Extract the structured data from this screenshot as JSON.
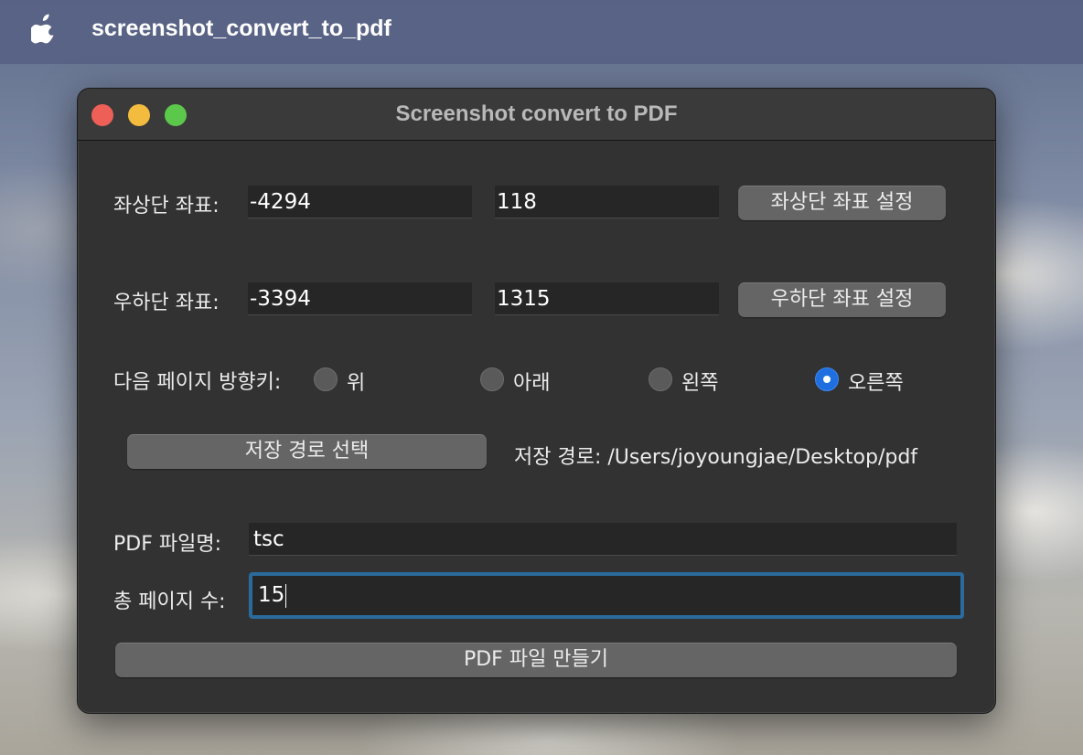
{
  "menubar": {
    "app_name": "screenshot_convert_to_pdf"
  },
  "window": {
    "title": "Screenshot convert to PDF"
  },
  "top_left": {
    "label": "좌상단 좌표:",
    "x_value": "-4294",
    "y_value": "118",
    "button_label": "좌상단 좌표 설정"
  },
  "bottom_right": {
    "label": "우하단 좌표:",
    "x_value": "-3394",
    "y_value": "1315",
    "button_label": "우하단 좌표 설정"
  },
  "direction": {
    "label": "다음 페이지 방향키:",
    "options": [
      {
        "label": "위",
        "selected": false
      },
      {
        "label": "아래",
        "selected": false
      },
      {
        "label": "왼쪽",
        "selected": false
      },
      {
        "label": "오른쪽",
        "selected": true
      }
    ]
  },
  "save_path": {
    "button_label": "저장 경로 선택",
    "display": "저장 경로: /Users/joyoungjae/Desktop/pdf"
  },
  "pdf_name": {
    "label": "PDF 파일명:",
    "value": "tsc"
  },
  "page_count": {
    "label": "총 페이지 수:",
    "value": "15"
  },
  "make_pdf": {
    "button_label": "PDF 파일 만들기"
  },
  "colors": {
    "accent": "#1f6fe0",
    "focus_ring": "#2a6a9c",
    "window_bg": "#323232"
  },
  "icons": [
    "apple-logo-icon",
    "close-icon",
    "minimize-icon",
    "zoom-icon"
  ]
}
